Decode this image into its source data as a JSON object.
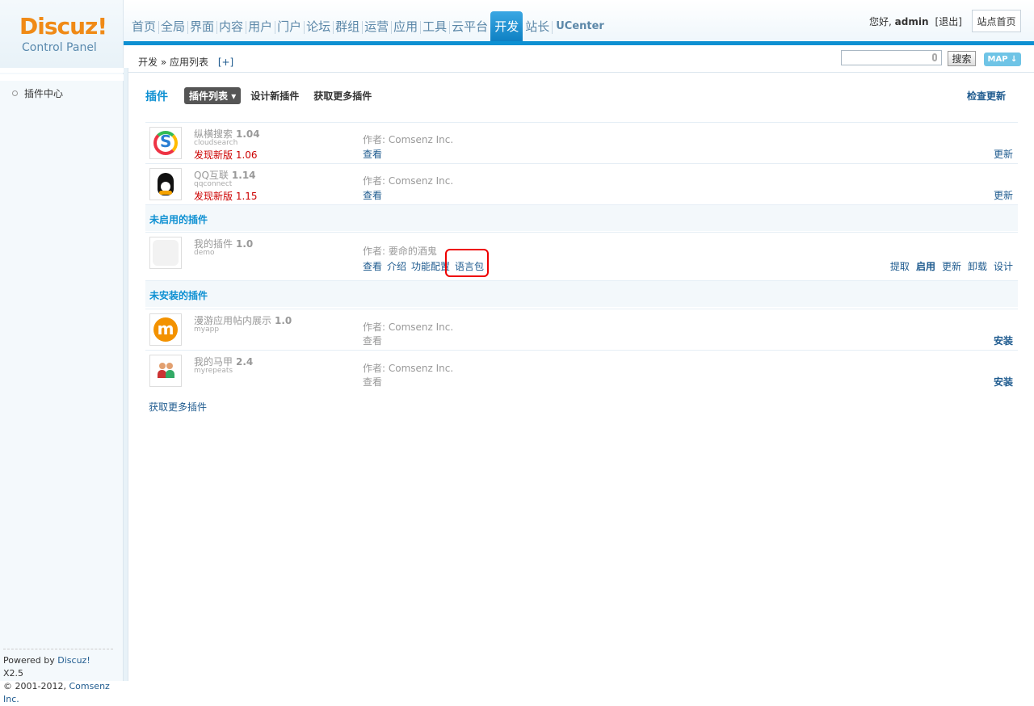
{
  "logo": {
    "main": "Discuz!",
    "sub": "Control Panel"
  },
  "nav": [
    "首页",
    "全局",
    "界面",
    "内容",
    "用户",
    "门户",
    "论坛",
    "群组",
    "运营",
    "应用",
    "工具",
    "云平台",
    "开发",
    "站长",
    "UCenter"
  ],
  "nav_active": "开发",
  "user": {
    "greeting": "您好,",
    "name": "admin",
    "logout": "[退出]",
    "site_home": "站点首页"
  },
  "breadcrumb": {
    "path": "开发 » 应用列表",
    "add": "[+]"
  },
  "search": {
    "value": "",
    "button": "搜索",
    "map": "MAP"
  },
  "sidebar": {
    "item": "插件中心"
  },
  "footer": {
    "powered": "Powered by",
    "product": "Discuz!",
    "version": "X2.5",
    "copyright": "© 2001-2012,",
    "company": "Comsenz Inc."
  },
  "tabs": {
    "title": "插件",
    "active": "插件列表",
    "design": "设计新插件",
    "more": "获取更多插件",
    "check": "检查更新"
  },
  "enabled_plugins": [
    {
      "name": "纵横搜索",
      "version": "1.04",
      "id": "cloudsearch",
      "new_version": "发现新版 1.06",
      "author": "作者: Comsenz Inc.",
      "links": [
        "查看"
      ],
      "actions": [
        "更新"
      ]
    },
    {
      "name": "QQ互联",
      "version": "1.14",
      "id": "qqconnect",
      "new_version": "发现新版 1.15",
      "author": "作者: Comsenz Inc.",
      "links": [
        "查看"
      ],
      "actions": [
        "更新"
      ]
    }
  ],
  "disabled_section": "未启用的插件",
  "disabled_plugins": [
    {
      "name": "我的插件",
      "version": "1.0",
      "id": "demo",
      "author": "作者: 要命的酒鬼",
      "links": [
        "查看",
        "介绍",
        "功能配置",
        "语言包"
      ],
      "actions": [
        "提取",
        "启用",
        "更新",
        "卸载",
        "设计"
      ]
    }
  ],
  "uninstalled_section": "未安装的插件",
  "uninstalled_plugins": [
    {
      "name": "漫游应用帖内展示",
      "version": "1.0",
      "id": "myapp",
      "author": "作者: Comsenz Inc.",
      "links": [
        "查看"
      ],
      "actions": [
        "安装"
      ]
    },
    {
      "name": "我的马甲",
      "version": "2.4",
      "id": "myrepeats",
      "author": "作者: Comsenz Inc.",
      "links": [
        "查看"
      ],
      "actions": [
        "安装"
      ]
    }
  ],
  "more_link": "获取更多插件"
}
